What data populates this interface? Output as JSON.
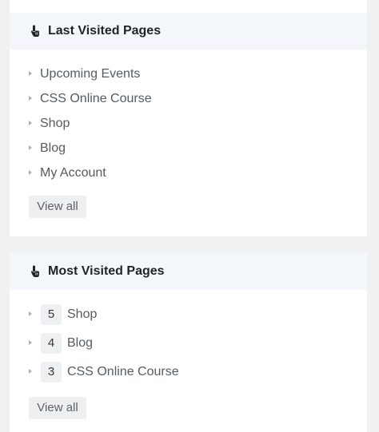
{
  "last_visited": {
    "title": "Last Visited Pages",
    "icon": "pointing-hand-icon",
    "items": [
      {
        "label": "Upcoming Events"
      },
      {
        "label": "CSS Online Course"
      },
      {
        "label": "Shop"
      },
      {
        "label": "Blog"
      },
      {
        "label": "My Account"
      }
    ],
    "view_all_label": "View all"
  },
  "most_visited": {
    "title": "Most Visited Pages",
    "icon": "pointing-hand-icon",
    "items": [
      {
        "count": "5",
        "label": "Shop"
      },
      {
        "count": "4",
        "label": "Blog"
      },
      {
        "count": "3",
        "label": "CSS Online Course"
      }
    ],
    "view_all_label": "View all"
  },
  "colors": {
    "background": "#f1f1f1",
    "panel": "#ffffff",
    "header": "#f3f7fb",
    "badge": "#eef0f2",
    "button": "#eeeff0"
  }
}
